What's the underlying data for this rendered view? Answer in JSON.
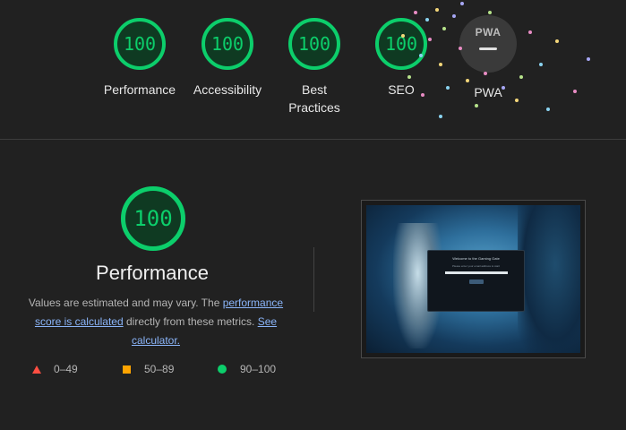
{
  "summary": {
    "gauges": [
      {
        "score": "100",
        "label": "Performance"
      },
      {
        "score": "100",
        "label": "Accessibility"
      },
      {
        "score": "100",
        "label": "Best Practices"
      },
      {
        "score": "100",
        "label": "SEO"
      }
    ],
    "pwa": {
      "badge_text": "PWA",
      "label": "PWA"
    }
  },
  "detail": {
    "score": "100",
    "title": "Performance",
    "desc_prefix": "Values are estimated and may vary. The ",
    "desc_link1": "performance score is calculated",
    "desc_middle": " directly from these metrics. ",
    "desc_link2": "See calculator.",
    "legend": [
      {
        "range": "0–49",
        "color": "#ff4e42",
        "icon": "triangle-icon"
      },
      {
        "range": "50–89",
        "color": "#ffa400",
        "icon": "square-icon"
      },
      {
        "range": "90–100",
        "color": "#0cce6b",
        "icon": "circle-icon"
      }
    ]
  },
  "screenshot": {
    "modal_title": "Welcome to the Gaming Gate",
    "modal_subtitle": "Please enter your email address to start",
    "button_label": "Start"
  },
  "colors": {
    "pass": "#0cce6b",
    "average": "#ffa400",
    "fail": "#ff4e42",
    "link": "#8ab4f8"
  }
}
